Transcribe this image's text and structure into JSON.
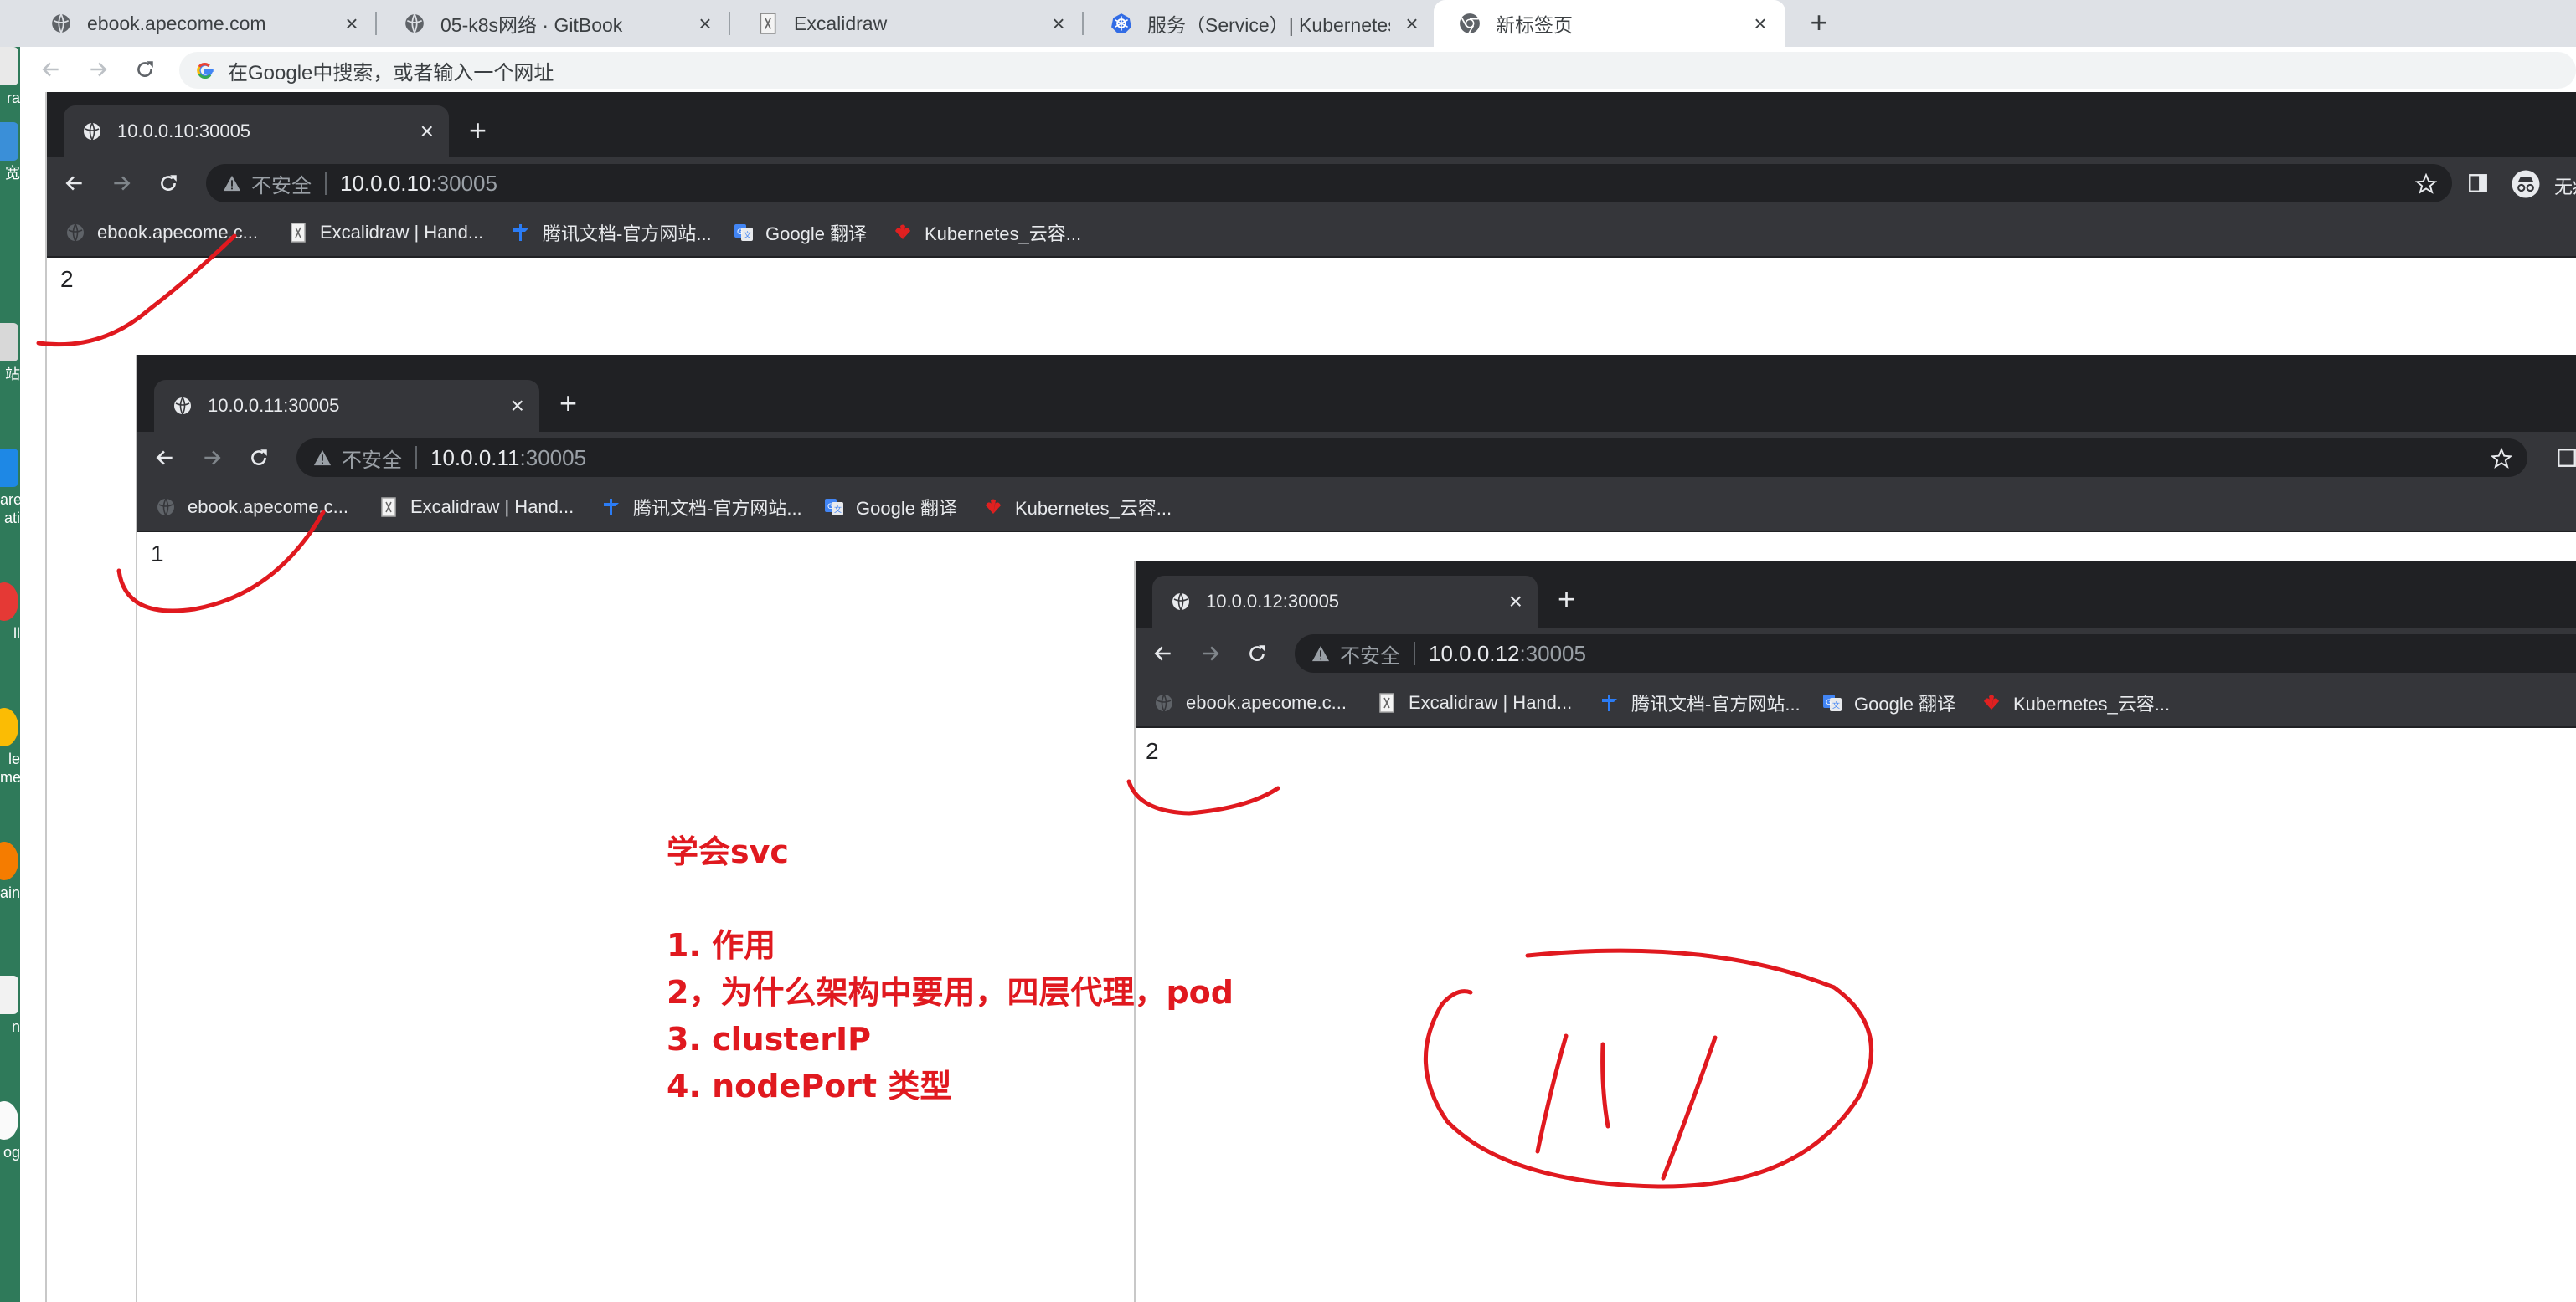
{
  "outer_browser": {
    "tabs": [
      {
        "title": "ebook.apecome.com",
        "icon": "globe-icon",
        "active": false
      },
      {
        "title": "05-k8s网络 · GitBook",
        "icon": "globe-icon",
        "active": false
      },
      {
        "title": "Excalidraw",
        "icon": "excalidraw-icon",
        "active": false
      },
      {
        "title": "服务（Service）| Kubernetes",
        "icon": "kubernetes-icon",
        "active": false
      },
      {
        "title": "新标签页",
        "icon": "chrome-icon",
        "active": true
      }
    ],
    "new_tab": "+",
    "omnibox_placeholder": "在Google中搜索，或者输入一个网址"
  },
  "desktop_labels": [
    "ra",
    "宽",
    "站",
    "are\nati",
    "ll",
    "le\nme",
    "ain",
    "n",
    "og"
  ],
  "windows": [
    {
      "tab_title": "10.0.0.10:30005",
      "security": "不安全",
      "host": "10.0.0.10",
      "port": ":30005",
      "content": "2",
      "profile_label": "无痕"
    },
    {
      "tab_title": "10.0.0.11:30005",
      "security": "不安全",
      "host": "10.0.0.11",
      "port": ":30005",
      "content": "1"
    },
    {
      "tab_title": "10.0.0.12:30005",
      "security": "不安全",
      "host": "10.0.0.12",
      "port": ":30005",
      "content": "2"
    }
  ],
  "bookmarks": [
    {
      "label": "ebook.apecome.c...",
      "icon": "globe-icon"
    },
    {
      "label": "Excalidraw | Hand...",
      "icon": "excalidraw-icon"
    },
    {
      "label": "腾讯文档-官方网站...",
      "icon": "tencent-docs-icon"
    },
    {
      "label": "Google 翻译",
      "icon": "google-translate-icon"
    },
    {
      "label": "Kubernetes_云容...",
      "icon": "huawei-cloud-icon"
    }
  ],
  "annotation": {
    "heading": "学会svc",
    "items": [
      "1. 作用",
      "2，为什么架构中要用，四层代理，pod",
      "3. clusterIP",
      "4. nodePort 类型"
    ],
    "color": "#e0191f"
  },
  "colors": {
    "dark_tabstrip": "#202124",
    "dark_toolbar": "#35363a",
    "light_tabstrip": "#dee1e6",
    "desktop": "#2f7a5a"
  }
}
